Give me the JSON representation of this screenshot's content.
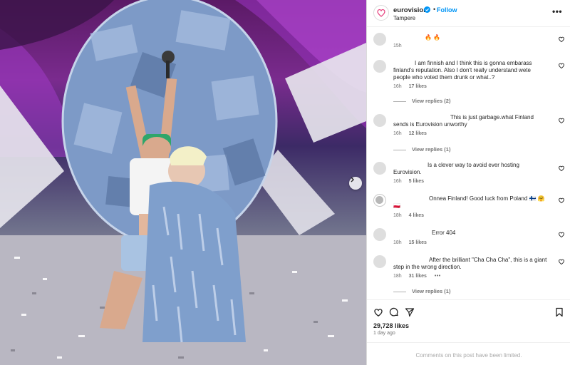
{
  "post": {
    "username": "eurovision",
    "follow_label": "Follow",
    "separator": "•",
    "location": "Tampere",
    "more_label": "•••",
    "likes_count": "29,728 likes",
    "time_ago": "1 day ago",
    "comments_limited_text": "Comments on this post have been limited."
  },
  "comments": [
    {
      "text": "🔥 🔥",
      "time": "15h",
      "likes": "",
      "more": ""
    },
    {
      "text": "I am finnish and I think this is gonna embarass finland's reputation. Also I don't really understand wete people who voted them drunk or what..?",
      "time": "16h",
      "likes": "17 likes",
      "more": "",
      "replies": "View replies (2)"
    },
    {
      "text": "This is just garbage.what Finland sends is Eurovision unworthy",
      "time": "16h",
      "likes": "12 likes",
      "more": "",
      "replies": "View replies (1)"
    },
    {
      "text": "Is a clever way to avoid ever hosting Eurovision.",
      "time": "16h",
      "likes": "5 likes",
      "more": ""
    },
    {
      "text": "Onnea Finland! Good luck from Poland 🇫🇮 🤗 🇵🇱",
      "time": "18h",
      "likes": "4 likes",
      "more": ""
    },
    {
      "text": "Error 404",
      "time": "18h",
      "likes": "15 likes",
      "more": ""
    },
    {
      "text": "After the brilliant \"Cha Cha Cha\", this is a giant step in the wrong direction.",
      "time": "18h",
      "likes": "31 likes",
      "more": "•••",
      "replies": "View replies (1)"
    }
  ],
  "icons": {
    "avatar": "eurovision-heart-logo",
    "verified": "verified-badge-icon",
    "next": "chevron-right-icon",
    "like": "heart-icon",
    "comment": "comment-bubble-icon",
    "share": "paper-plane-icon",
    "save": "bookmark-icon"
  },
  "colors": {
    "accent": "#0095f6",
    "muted": "#737373",
    "text": "#262626"
  }
}
